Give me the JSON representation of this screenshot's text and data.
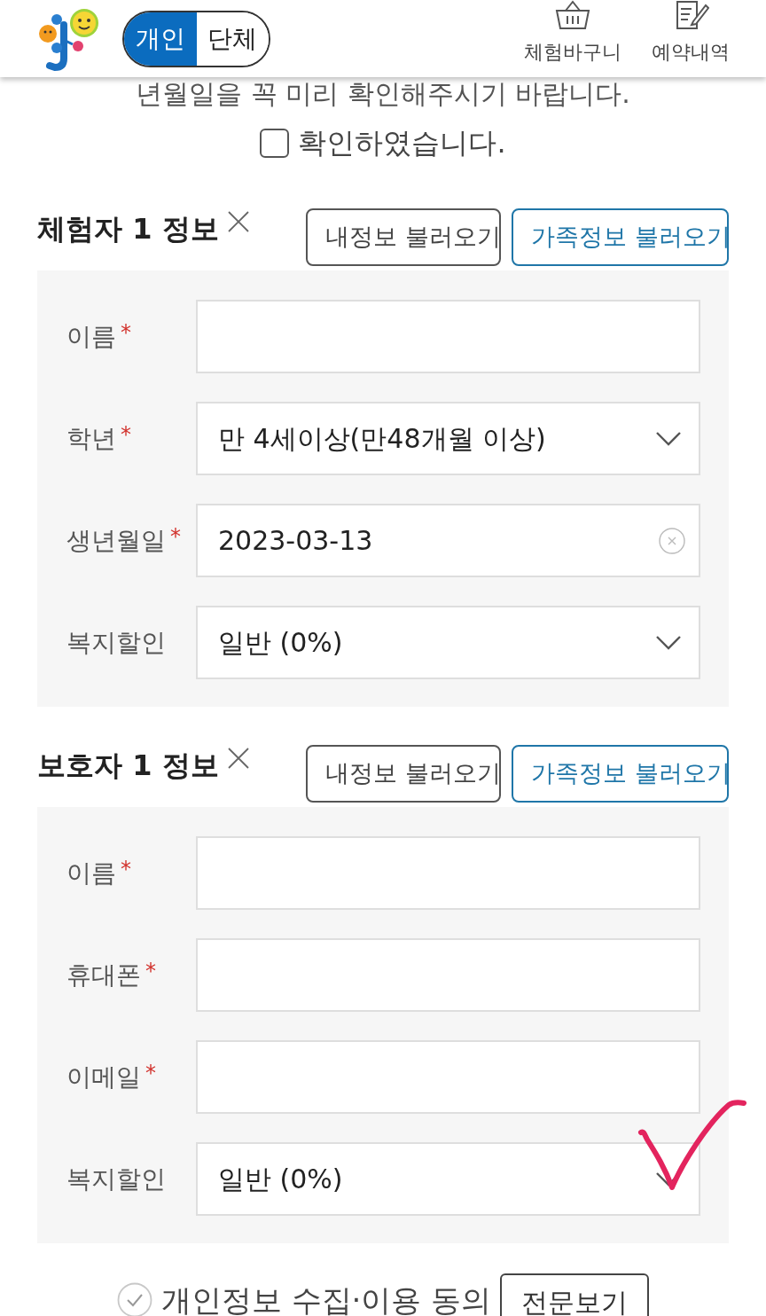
{
  "header": {
    "mode_toggle": [
      {
        "label": "개인",
        "selected": true
      },
      {
        "label": "단체",
        "selected": false
      }
    ],
    "actions": [
      {
        "kind": "basket",
        "label": "체험바구니"
      },
      {
        "kind": "reservations",
        "label": "예약내역"
      }
    ]
  },
  "notice": {
    "text": "년월일을 꼭 미리 확인해주시기 바랍니다.",
    "confirm": {
      "label": "확인하였습니다.",
      "checked": false
    }
  },
  "sections": [
    {
      "title": "체험자 1 정보",
      "buttons": [
        {
          "kind": "default",
          "label": "내정보 불러오기"
        },
        {
          "kind": "primary",
          "label": "가족정보 불러오기"
        }
      ],
      "fields": [
        {
          "label": "이름",
          "mark": "*",
          "kind": "text"
        },
        {
          "label": "학년",
          "mark": "*",
          "kind": "select",
          "value": "만 4세이상(만48개월 이상)"
        },
        {
          "label": "생년월일",
          "mark": "*",
          "kind": "date",
          "value": "2023-03-13"
        },
        {
          "label": "복지할인",
          "kind": "select",
          "value": "일반 (0%)"
        }
      ]
    },
    {
      "title": "보호자 1 정보",
      "buttons": [
        {
          "kind": "default",
          "label": "내정보 불러오기"
        },
        {
          "kind": "primary",
          "label": "가족정보 불러오기"
        }
      ],
      "fields": [
        {
          "label": "이름",
          "mark": "*",
          "kind": "text"
        },
        {
          "label": "휴대폰",
          "mark": "*",
          "kind": "text"
        },
        {
          "label": "이메일",
          "mark": "*",
          "kind": "text"
        },
        {
          "label": "복지할인",
          "kind": "select",
          "value": "일반 (0%)"
        }
      ]
    }
  ],
  "consent": {
    "label": "개인정보 수집·이용 동의",
    "checked": false,
    "button": "전문보기"
  }
}
